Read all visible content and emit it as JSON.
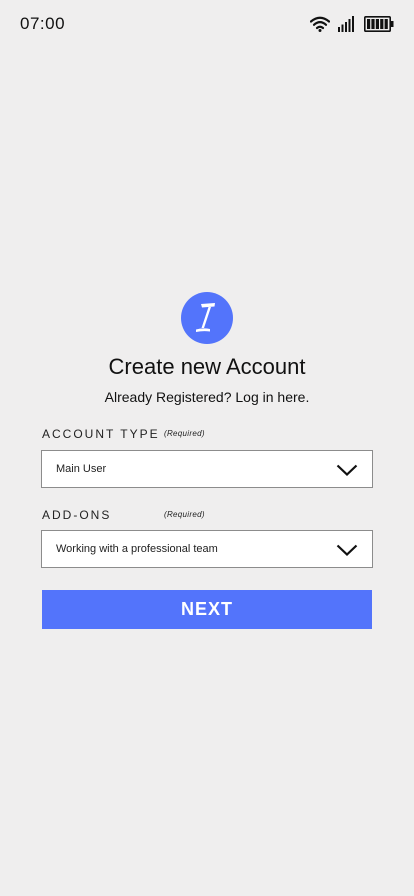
{
  "status_bar": {
    "time": "07:00",
    "icons": [
      "wifi-icon",
      "signal-icon",
      "battery-icon"
    ]
  },
  "logo": {
    "icon": "pen-logo-icon",
    "color": "#5374fb"
  },
  "header": {
    "title": "Create new Account",
    "subtitle": "Already Registered? Log in here."
  },
  "form": {
    "account_type": {
      "label": "ACCOUNT TYPE",
      "required": "(Required)",
      "value": "Main User",
      "icon": "chevron-down-icon"
    },
    "add_ons": {
      "label": "ADD-ONS",
      "required": "(Required)",
      "value": "Working with a professional team",
      "icon": "chevron-down-icon"
    },
    "next_label": "NEXT"
  },
  "colors": {
    "accent": "#5374fb",
    "background": "#efeeee"
  }
}
